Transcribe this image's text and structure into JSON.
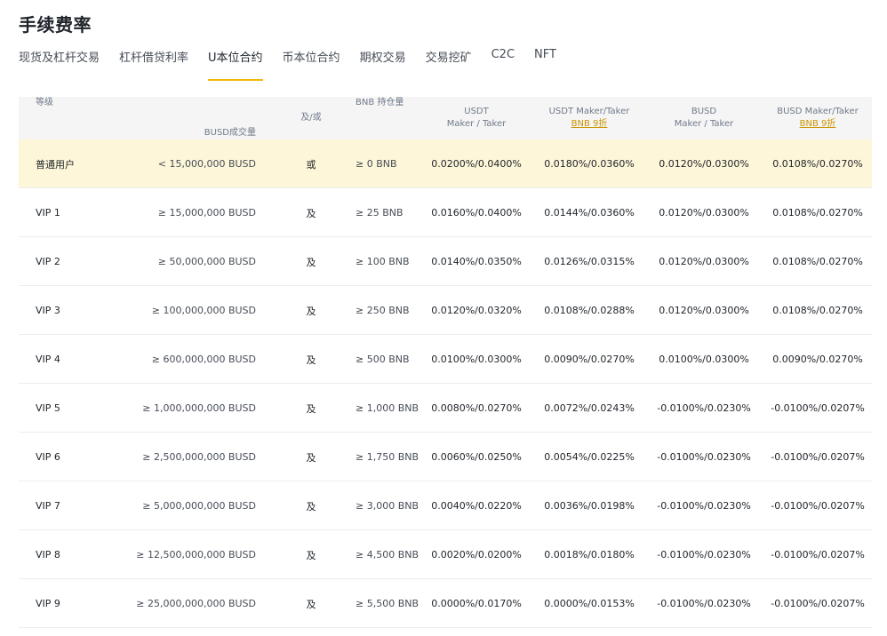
{
  "page": {
    "title": "手续费率"
  },
  "tabs": [
    {
      "label": "现货及杠杆交易"
    },
    {
      "label": "杠杆借贷利率"
    },
    {
      "label": "U本位合约",
      "active": true
    },
    {
      "label": "币本位合约"
    },
    {
      "label": "期权交易"
    },
    {
      "label": "交易挖矿"
    },
    {
      "label": "C2C"
    },
    {
      "label": "NFT"
    }
  ],
  "table": {
    "headers": {
      "level": "等级",
      "volume": "BUSD成交量",
      "andor": "及/或",
      "bnb": "BNB 持仓量",
      "usdt_line1": "USDT",
      "usdt_line2": "Maker / Taker",
      "usdt_bnb_line1": "USDT Maker/Taker",
      "usdt_bnb_line2": "BNB 9折",
      "busd_line1": "BUSD",
      "busd_line2": "Maker / Taker",
      "busd_bnb_line1": "BUSD Maker/Taker",
      "busd_bnb_line2": "BNB 9折"
    },
    "rows": [
      {
        "level": "普通用户",
        "volume": "< 15,000,000 BUSD",
        "andor": "或",
        "bnb": "≥ 0 BNB",
        "usdt": "0.0200%/0.0400%",
        "usdt_bnb": "0.0180%/0.0360%",
        "busd": "0.0120%/0.0300%",
        "busd_bnb": "0.0108%/0.0270%"
      },
      {
        "level": "VIP 1",
        "volume": "≥ 15,000,000 BUSD",
        "andor": "及",
        "bnb": "≥ 25 BNB",
        "usdt": "0.0160%/0.0400%",
        "usdt_bnb": "0.0144%/0.0360%",
        "busd": "0.0120%/0.0300%",
        "busd_bnb": "0.0108%/0.0270%"
      },
      {
        "level": "VIP 2",
        "volume": "≥ 50,000,000 BUSD",
        "andor": "及",
        "bnb": "≥ 100 BNB",
        "usdt": "0.0140%/0.0350%",
        "usdt_bnb": "0.0126%/0.0315%",
        "busd": "0.0120%/0.0300%",
        "busd_bnb": "0.0108%/0.0270%"
      },
      {
        "level": "VIP 3",
        "volume": "≥ 100,000,000 BUSD",
        "andor": "及",
        "bnb": "≥ 250 BNB",
        "usdt": "0.0120%/0.0320%",
        "usdt_bnb": "0.0108%/0.0288%",
        "busd": "0.0120%/0.0300%",
        "busd_bnb": "0.0108%/0.0270%"
      },
      {
        "level": "VIP 4",
        "volume": "≥ 600,000,000 BUSD",
        "andor": "及",
        "bnb": "≥ 500 BNB",
        "usdt": "0.0100%/0.0300%",
        "usdt_bnb": "0.0090%/0.0270%",
        "busd": "0.0100%/0.0300%",
        "busd_bnb": "0.0090%/0.0270%"
      },
      {
        "level": "VIP 5",
        "volume": "≥ 1,000,000,000 BUSD",
        "andor": "及",
        "bnb": "≥ 1,000 BNB",
        "usdt": "0.0080%/0.0270%",
        "usdt_bnb": "0.0072%/0.0243%",
        "busd": "-0.0100%/0.0230%",
        "busd_bnb": "-0.0100%/0.0207%"
      },
      {
        "level": "VIP 6",
        "volume": "≥ 2,500,000,000 BUSD",
        "andor": "及",
        "bnb": "≥ 1,750 BNB",
        "usdt": "0.0060%/0.0250%",
        "usdt_bnb": "0.0054%/0.0225%",
        "busd": "-0.0100%/0.0230%",
        "busd_bnb": "-0.0100%/0.0207%"
      },
      {
        "level": "VIP 7",
        "volume": "≥ 5,000,000,000 BUSD",
        "andor": "及",
        "bnb": "≥ 3,000 BNB",
        "usdt": "0.0040%/0.0220%",
        "usdt_bnb": "0.0036%/0.0198%",
        "busd": "-0.0100%/0.0230%",
        "busd_bnb": "-0.0100%/0.0207%"
      },
      {
        "level": "VIP 8",
        "volume": "≥ 12,500,000,000 BUSD",
        "andor": "及",
        "bnb": "≥ 4,500 BNB",
        "usdt": "0.0020%/0.0200%",
        "usdt_bnb": "0.0018%/0.0180%",
        "busd": "-0.0100%/0.0230%",
        "busd_bnb": "-0.0100%/0.0207%"
      },
      {
        "level": "VIP 9",
        "volume": "≥ 25,000,000,000 BUSD",
        "andor": "及",
        "bnb": "≥ 5,500 BNB",
        "usdt": "0.0000%/0.0170%",
        "usdt_bnb": "0.0000%/0.0153%",
        "busd": "-0.0100%/0.0230%",
        "busd_bnb": "-0.0100%/0.0207%"
      }
    ]
  },
  "colors": {
    "accent": "#f0b90b",
    "link": "#c99400",
    "highlight_row": "#fef6d8",
    "header_bg": "#f5f5f5"
  }
}
